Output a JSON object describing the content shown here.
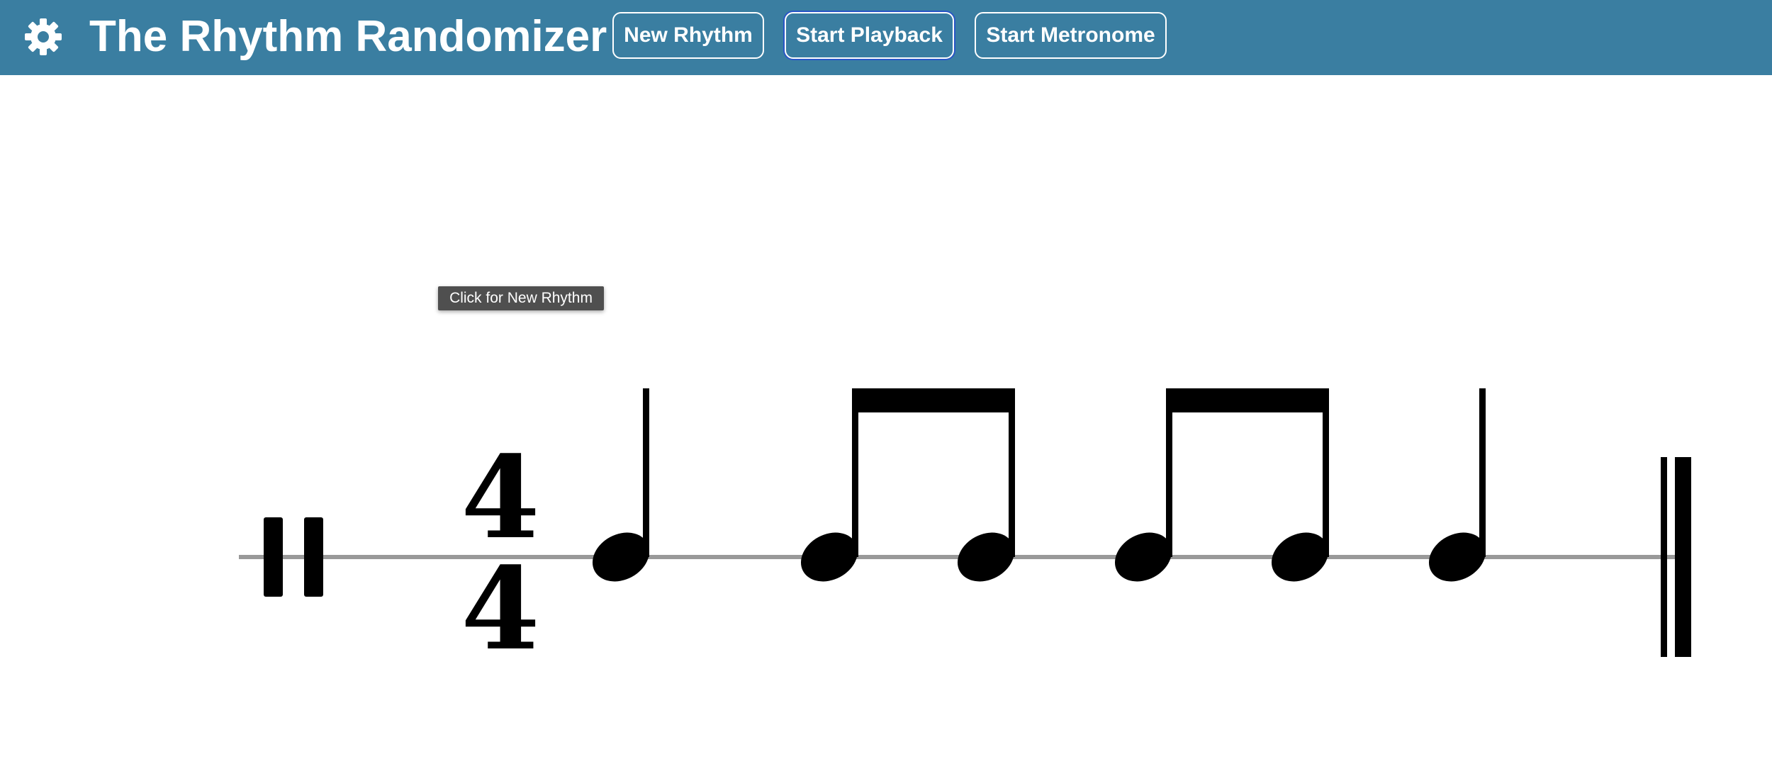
{
  "header": {
    "title": "The Rhythm Randomizer",
    "settings_icon": "gear-icon",
    "background_color": "#3a7ea1",
    "buttons": [
      {
        "label": "New Rhythm"
      },
      {
        "label": "Start Playback",
        "focused": true
      },
      {
        "label": "Start Metronome"
      }
    ]
  },
  "tooltip": {
    "text": "Click for New Rhythm"
  },
  "rhythm": {
    "clef": "percussion-clef",
    "time_signature": {
      "numerator": "4",
      "denominator": "4"
    },
    "notes": [
      {
        "type": "quarter"
      },
      {
        "type": "eighth",
        "beamed_with_next": true
      },
      {
        "type": "eighth"
      },
      {
        "type": "eighth",
        "beamed_with_next": true
      },
      {
        "type": "eighth"
      },
      {
        "type": "quarter"
      }
    ],
    "end_barline": "final-double-barline",
    "staff_color": "#999999"
  }
}
